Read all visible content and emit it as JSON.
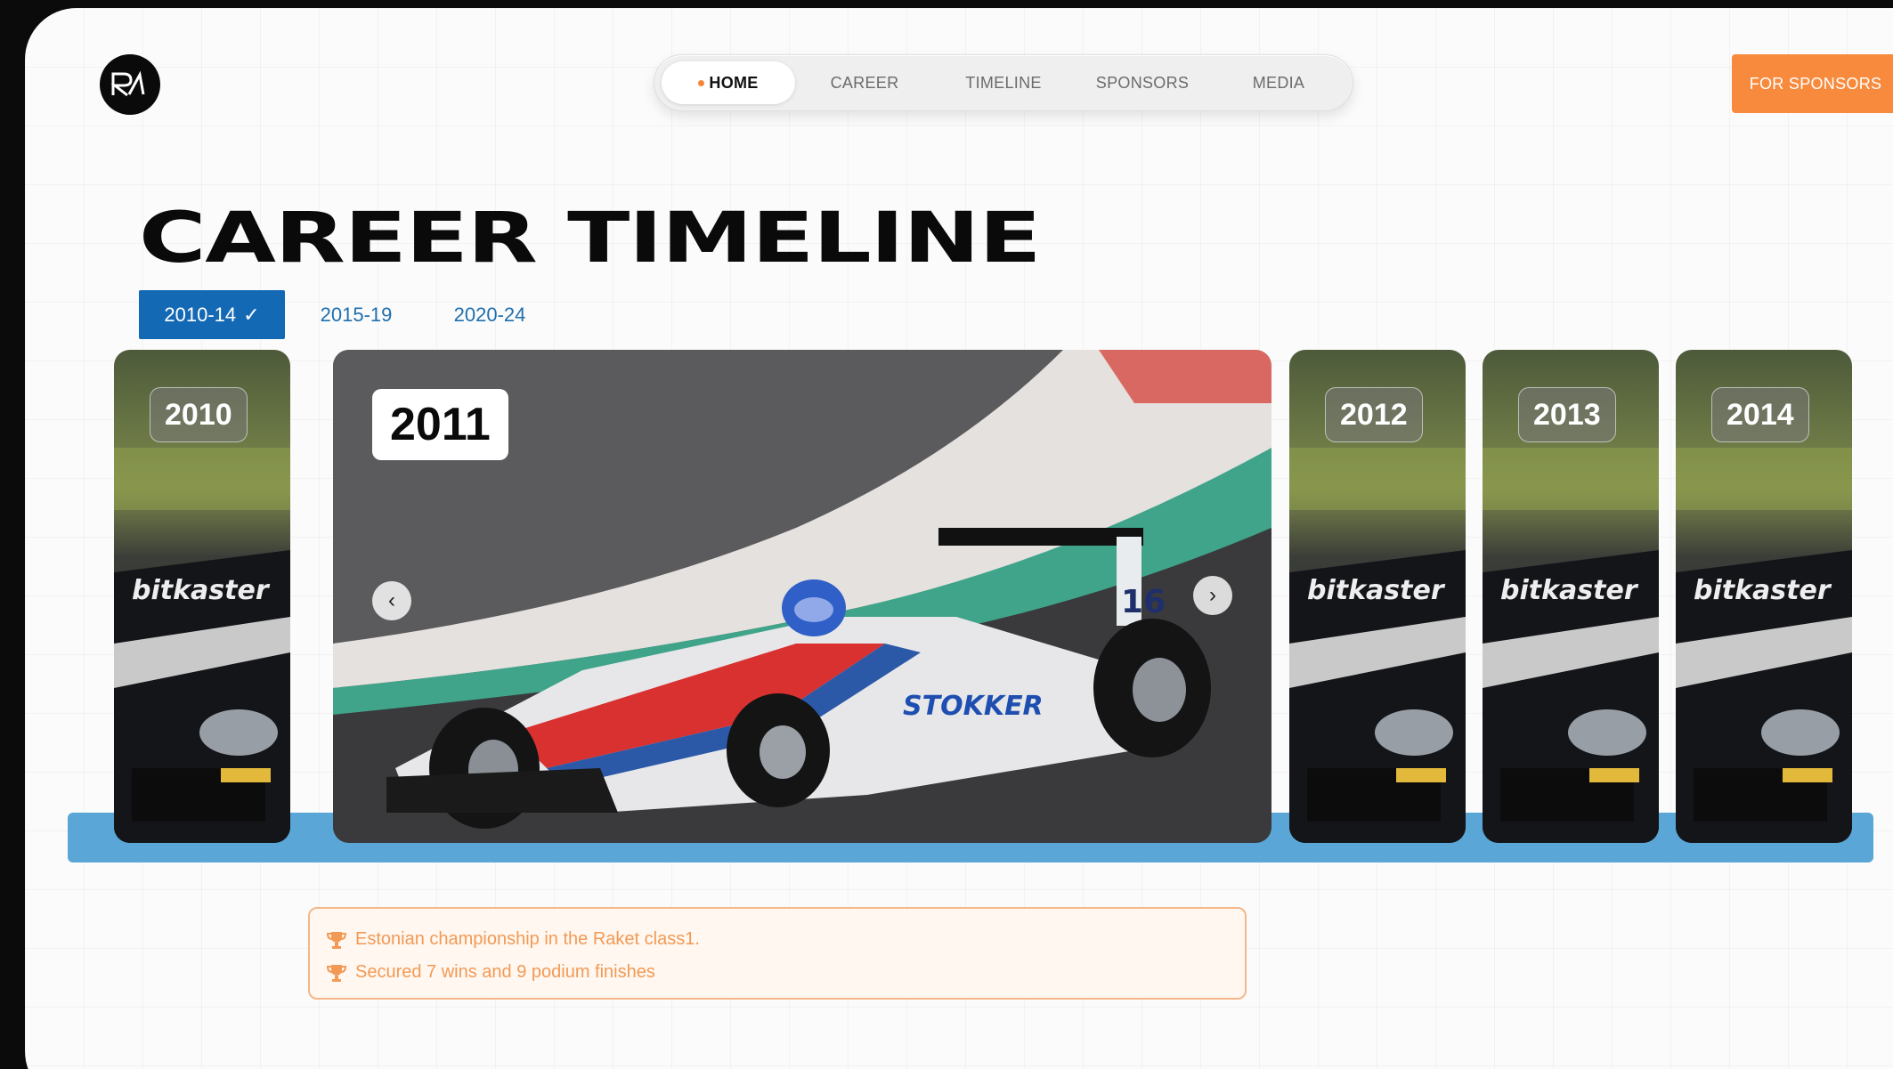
{
  "header": {
    "logo_text": "RA",
    "nav": [
      {
        "label": "HOME",
        "active": true
      },
      {
        "label": "CAREER",
        "active": false
      },
      {
        "label": "TIMELINE",
        "active": false
      },
      {
        "label": "SPONSORS",
        "active": false
      },
      {
        "label": "MEDIA",
        "active": false
      }
    ],
    "cta_label": "FOR SPONSORS"
  },
  "timeline": {
    "title": "CAREER TIMELINE",
    "tabs": [
      {
        "label": "2010-14",
        "active": true,
        "icon": "check-icon"
      },
      {
        "label": "2015-19",
        "active": false
      },
      {
        "label": "2020-24",
        "active": false
      }
    ],
    "years": [
      "2010",
      "2011",
      "2012",
      "2013",
      "2014"
    ],
    "active_year": "2011",
    "achievements": [
      "Estonian championship in the Raket class1.",
      "Secured 7 wins and 9 podium finishes"
    ]
  },
  "colors": {
    "accent_orange": "#f78a3c",
    "tab_blue": "#1469b5",
    "band_blue": "#5aa6d6",
    "achievement_text": "#f29a55"
  }
}
